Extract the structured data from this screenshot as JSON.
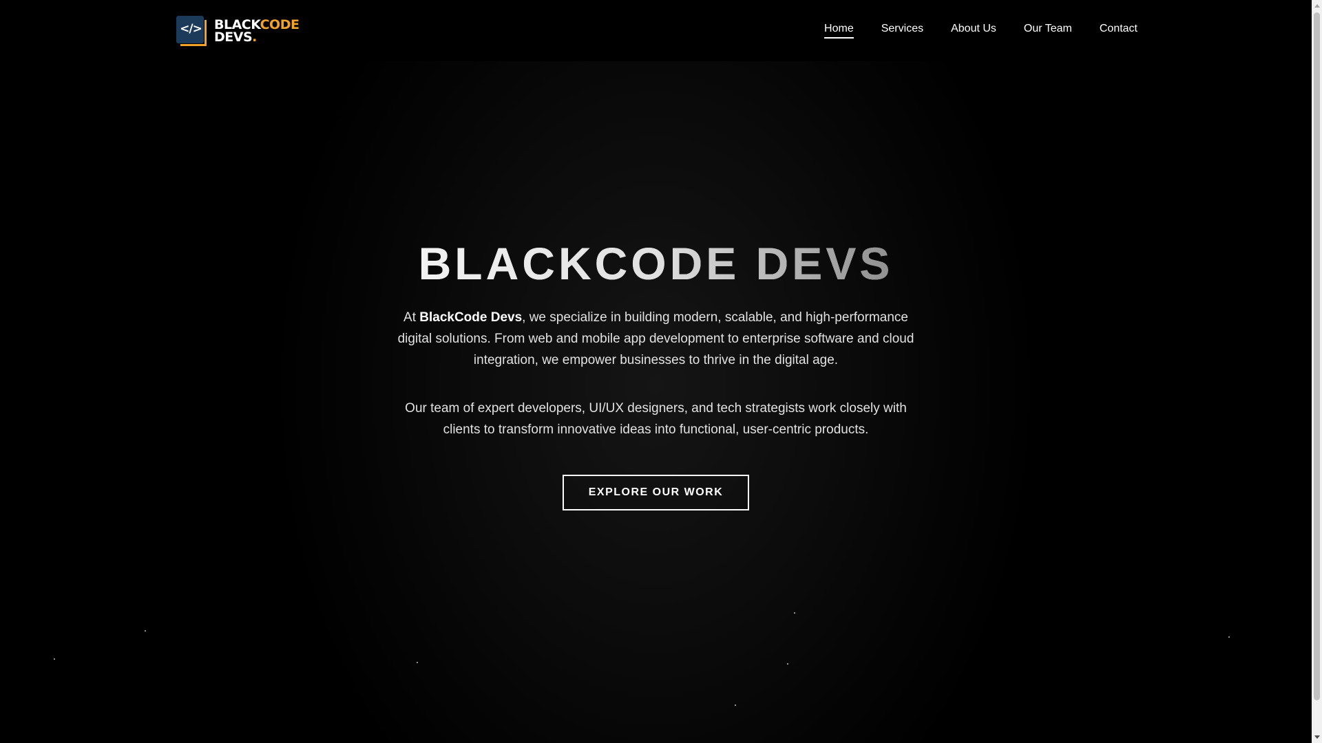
{
  "brand": {
    "logo_symbol": "</>",
    "logo_word_white": "BLACK",
    "logo_word_orange": "CODE",
    "logo_line2": "DEVS",
    "logo_dot": ".",
    "colors": {
      "logo_square": "#1c3a5a",
      "logo_accent": "#f2a12a"
    }
  },
  "nav": {
    "items": [
      {
        "label": "Home",
        "active": true
      },
      {
        "label": "Services",
        "active": false
      },
      {
        "label": "About Us",
        "active": false
      },
      {
        "label": "Our Team",
        "active": false
      },
      {
        "label": "Contact",
        "active": false
      }
    ]
  },
  "hero": {
    "title": "BLACKCODE DEVS",
    "p1_prefix": "At ",
    "p1_brand": "BlackCode Devs",
    "p1_rest": ", we specialize in building modern, scalable, and high-performance digital solutions. From web and mobile app development to enterprise software and cloud integration, we empower businesses to thrive in the digital age.",
    "p2": "Our team of expert developers, UI/UX designers, and tech strategists work closely with clients to transform innovative ideas into functional, user-centric products.",
    "cta_label": "EXPLORE OUR WORK"
  }
}
